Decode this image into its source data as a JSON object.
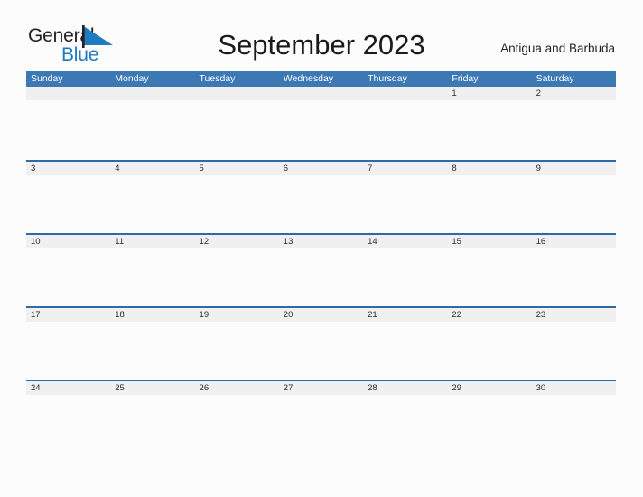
{
  "logo": {
    "word_one": "General",
    "word_two": "Blue",
    "flag_icon": "blue-flag-triangle-icon",
    "primary_color": "#1f7ac0",
    "text_color": "#231f20"
  },
  "header": {
    "title": "September 2023",
    "country": "Antigua and Barbuda"
  },
  "theme": {
    "header_blue": "#3c78b4",
    "rule_blue": "#2b6ca8",
    "band_gray": "#f0f0f0",
    "page_background": "#fcfcfc"
  },
  "calendar": {
    "weekdays": [
      "Sunday",
      "Monday",
      "Tuesday",
      "Wednesday",
      "Thursday",
      "Friday",
      "Saturday"
    ],
    "weeks": [
      [
        "",
        "",
        "",
        "",
        "",
        "1",
        "2"
      ],
      [
        "3",
        "4",
        "5",
        "6",
        "7",
        "8",
        "9"
      ],
      [
        "10",
        "11",
        "12",
        "13",
        "14",
        "15",
        "16"
      ],
      [
        "17",
        "18",
        "19",
        "20",
        "21",
        "22",
        "23"
      ],
      [
        "24",
        "25",
        "26",
        "27",
        "28",
        "29",
        "30"
      ]
    ]
  }
}
